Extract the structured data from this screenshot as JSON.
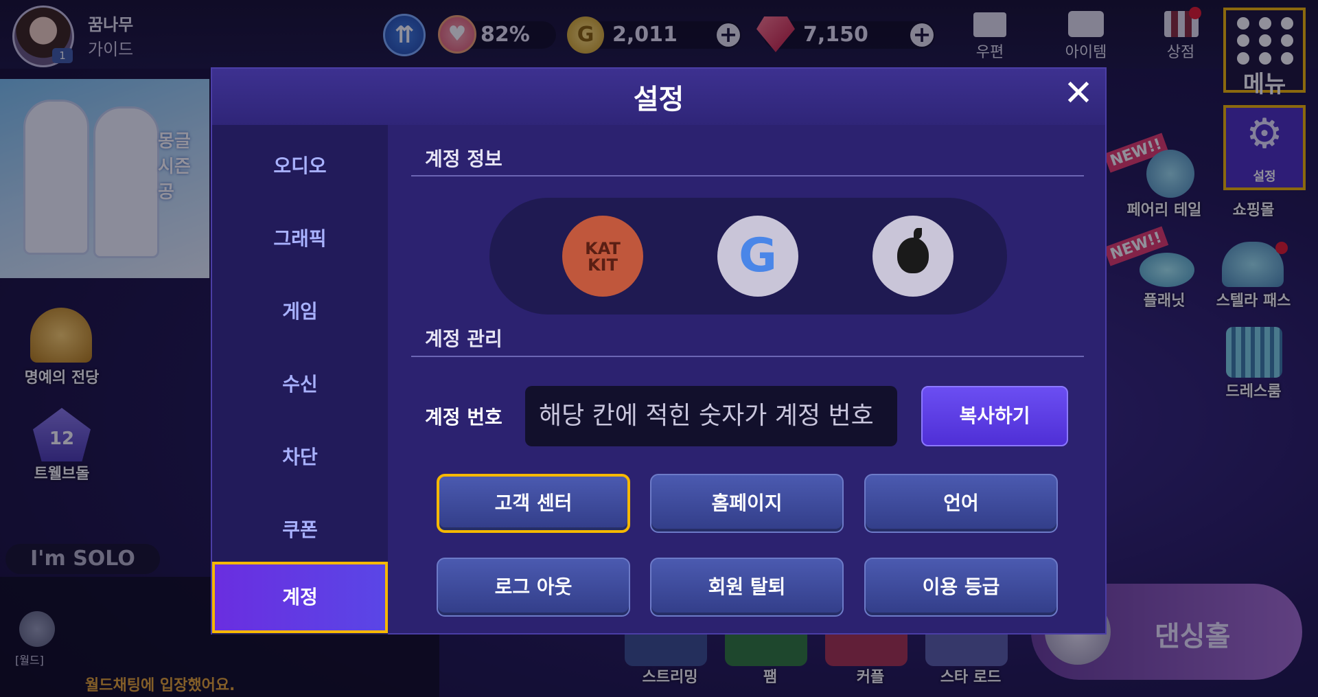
{
  "player": {
    "name": "꿈나무",
    "rank": "가이드",
    "level": "1"
  },
  "resources": {
    "heart_percent": "82%",
    "gold": "2,011",
    "gems": "7,150"
  },
  "top_icons": [
    {
      "label": "우편"
    },
    {
      "label": "아이템"
    },
    {
      "label": "상점"
    }
  ],
  "menu": {
    "label": "메뉴"
  },
  "settings_shortcut": {
    "label": "설정"
  },
  "left_side": {
    "banner_text": "몽글 시즌 공",
    "hall_of_fame": "명예의 전당",
    "twelve_doll": "트웰브돌",
    "crown_number": "12",
    "solo_label": "I'm SOLO",
    "world_label": "[월드]",
    "chat_message": "월드채팅에 입장했어요."
  },
  "right_side": {
    "fairy_tale": "페어리 테일",
    "shopping_mall": "쇼핑몰",
    "planet": "플래닛",
    "stella_pass": "스텔라 패스",
    "dressroom": "드레스룸",
    "new_badge": "NEW!!"
  },
  "bottom_bar": [
    "스트리밍",
    "팸",
    "커플",
    "스타 로드"
  ],
  "dance_hall": "댄싱홀",
  "modal": {
    "title": "설정",
    "close": "✕",
    "tabs": [
      {
        "label": "오디오"
      },
      {
        "label": "그래픽"
      },
      {
        "label": "게임"
      },
      {
        "label": "수신"
      },
      {
        "label": "차단"
      },
      {
        "label": "쿠폰"
      },
      {
        "label": "계정"
      }
    ],
    "active_tab": "계정",
    "account_info_title": "계정 정보",
    "social_logins": [
      {
        "name": "KAKAO",
        "logo_text": "KAT KIT",
        "color": "#c0573c"
      },
      {
        "name": "Google",
        "logo_text": "G",
        "color": "#c9c5d8"
      },
      {
        "name": "Apple",
        "logo_text": "",
        "color": "#c9c5d8"
      }
    ],
    "account_manage_title": "계정 관리",
    "account_number_label": "계정 번호",
    "account_number_value": "해당 칸에 적힌 숫자가 계정 번호",
    "copy_button": "복사하기",
    "buttons": [
      {
        "label": "고객 센터"
      },
      {
        "label": "홈페이지"
      },
      {
        "label": "언어"
      },
      {
        "label": "로그 아웃"
      },
      {
        "label": "회원 탈퇴"
      },
      {
        "label": "이용 등급"
      }
    ]
  },
  "colors": {
    "highlight": "#f5b800",
    "modal_bg": "#2c2270",
    "active_tab": "#5a46e6"
  }
}
